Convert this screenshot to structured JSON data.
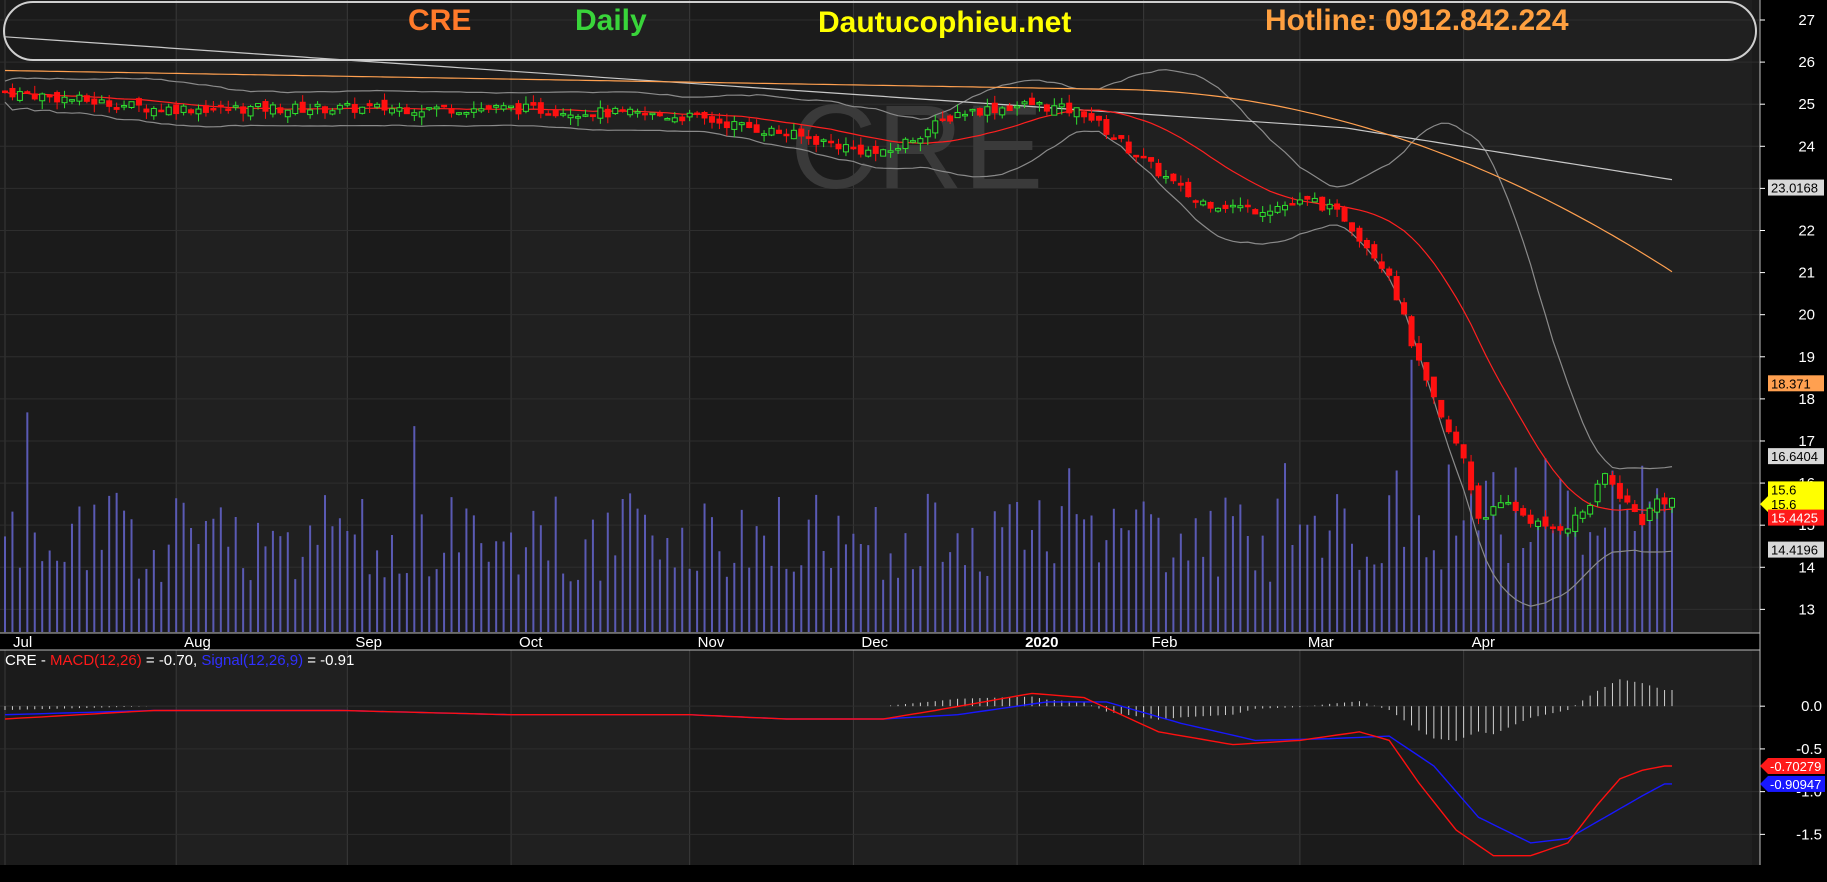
{
  "header": {
    "ticker": "CRE",
    "period": "Daily",
    "site": "Dautucophieu.net",
    "hotline": "Hotline: 0912.842.224"
  },
  "watermark": "CRE",
  "macd_legend": {
    "ticker": "CRE",
    "dash": " - ",
    "macd_name": "MACD(12,26)",
    "macd_value": " = -0.70, ",
    "signal_name": "Signal(12,26,9)",
    "signal_value": " = -0.91"
  },
  "colors": {
    "ticker": "#ff7a2a",
    "period": "#39d43a",
    "site": "#ffff00",
    "hotline": "#ffa040",
    "up": "#2fe02f",
    "down": "#ff1010",
    "ma20": "#ff2020",
    "ma50": "#ffa050",
    "ma200": "#c8c8c8",
    "bollinger": "#8a8a8a",
    "volume": "#5a5ab4",
    "macd": "#ff1010",
    "signal": "#1818ff",
    "hist": "#d0d0d0"
  },
  "chart_data": {
    "type": "candlestick",
    "price_axis": {
      "min": 12.7,
      "max": 27,
      "ticks": [
        "13",
        "14",
        "15",
        "16",
        "17",
        "18",
        "19",
        "20",
        "21",
        "22",
        "23",
        "24",
        "25",
        "26",
        "27"
      ]
    },
    "macd_axis": {
      "min": -1.8,
      "max": 0.4,
      "ticks": [
        "0.0",
        "-0.5",
        "-1.0",
        "-1.5"
      ]
    },
    "months": [
      "Jul",
      "Aug",
      "Sep",
      "Oct",
      "Nov",
      "Dec",
      "2020",
      "Feb",
      "Mar",
      "Apr"
    ],
    "month_start_index": [
      0,
      23,
      46,
      68,
      92,
      114,
      136,
      153,
      174,
      196
    ],
    "price_tags": [
      {
        "label": "23.0168",
        "value": 23.02,
        "kind": "ma200"
      },
      {
        "label": "18.371",
        "value": 18.37,
        "kind": "ma50"
      },
      {
        "label": "16.6404",
        "value": 16.64,
        "kind": "upper_band"
      },
      {
        "label": "15.6",
        "value": 15.85,
        "kind": "close"
      },
      {
        "label": "15.6",
        "value": 15.5,
        "kind": "last"
      },
      {
        "label": "15.4425",
        "value": 15.18,
        "kind": "ma20"
      },
      {
        "label": "14.4196",
        "value": 14.42,
        "kind": "lower_band"
      }
    ],
    "macd_tags": [
      {
        "label": "-0.70279",
        "value": -0.7,
        "kind": "macd"
      },
      {
        "label": "-0.90947",
        "value": -0.91,
        "kind": "signal"
      }
    ],
    "close_keyframes": [
      [
        0,
        25.3
      ],
      [
        20,
        24.9
      ],
      [
        45,
        24.9
      ],
      [
        68,
        24.9
      ],
      [
        92,
        24.7
      ],
      [
        105,
        24.3
      ],
      [
        118,
        23.8
      ],
      [
        128,
        24.8
      ],
      [
        138,
        25.0
      ],
      [
        145,
        24.8
      ],
      [
        152,
        23.8
      ],
      [
        160,
        22.7
      ],
      [
        168,
        22.5
      ],
      [
        176,
        22.7
      ],
      [
        180,
        22.3
      ],
      [
        186,
        21.0
      ],
      [
        190,
        18.8
      ],
      [
        193,
        17.5
      ],
      [
        196,
        16.6
      ],
      [
        198,
        15.2
      ],
      [
        202,
        15.5
      ],
      [
        207,
        14.9
      ],
      [
        210,
        15.0
      ],
      [
        213,
        15.5
      ],
      [
        215,
        16.2
      ],
      [
        218,
        15.5
      ],
      [
        220,
        15.1
      ],
      [
        222,
        15.6
      ]
    ],
    "macd_keyframes": [
      [
        0,
        -0.15
      ],
      [
        20,
        -0.05
      ],
      [
        45,
        -0.05
      ],
      [
        68,
        -0.1
      ],
      [
        92,
        -0.1
      ],
      [
        105,
        -0.15
      ],
      [
        118,
        -0.15
      ],
      [
        125,
        -0.05
      ],
      [
        138,
        0.15
      ],
      [
        145,
        0.1
      ],
      [
        155,
        -0.3
      ],
      [
        165,
        -0.45
      ],
      [
        174,
        -0.4
      ],
      [
        182,
        -0.3
      ],
      [
        186,
        -0.4
      ],
      [
        190,
        -0.9
      ],
      [
        195,
        -1.45
      ],
      [
        200,
        -1.75
      ],
      [
        205,
        -1.75
      ],
      [
        210,
        -1.6
      ],
      [
        214,
        -1.15
      ],
      [
        217,
        -0.85
      ],
      [
        220,
        -0.75
      ],
      [
        223,
        -0.7
      ]
    ],
    "signal_keyframes": [
      [
        0,
        -0.1
      ],
      [
        20,
        -0.05
      ],
      [
        45,
        -0.05
      ],
      [
        68,
        -0.1
      ],
      [
        92,
        -0.1
      ],
      [
        105,
        -0.15
      ],
      [
        118,
        -0.15
      ],
      [
        128,
        -0.1
      ],
      [
        140,
        0.05
      ],
      [
        148,
        0.05
      ],
      [
        158,
        -0.2
      ],
      [
        168,
        -0.4
      ],
      [
        178,
        -0.38
      ],
      [
        186,
        -0.35
      ],
      [
        192,
        -0.7
      ],
      [
        198,
        -1.3
      ],
      [
        205,
        -1.6
      ],
      [
        210,
        -1.55
      ],
      [
        215,
        -1.3
      ],
      [
        220,
        -1.05
      ],
      [
        223,
        -0.91
      ]
    ]
  }
}
